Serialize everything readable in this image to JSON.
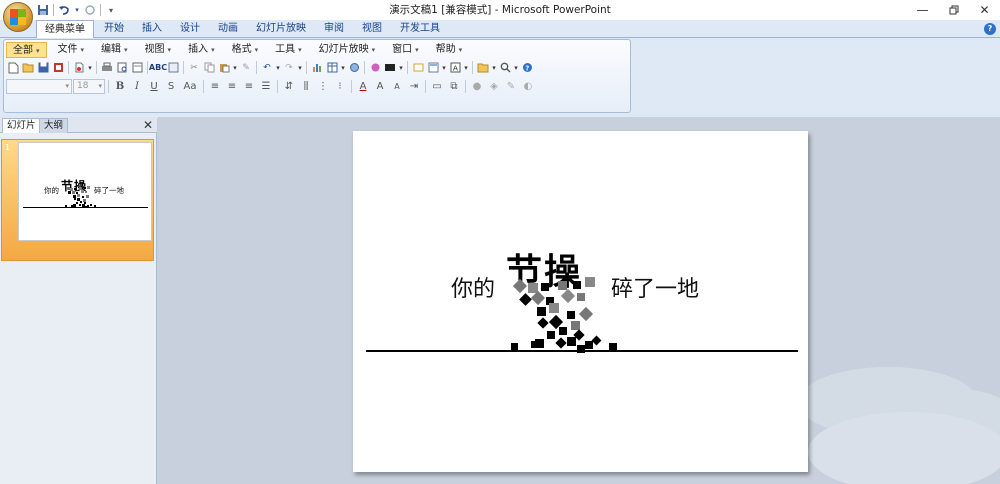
{
  "titlebar": {
    "title": "演示文稿1 [兼容模式] - Microsoft PowerPoint",
    "qat_icons": [
      "save-icon",
      "undo-icon",
      "redo-icon",
      "customize-icon"
    ]
  },
  "tabs": [
    {
      "label": "经典菜单",
      "active": true
    },
    {
      "label": "开始"
    },
    {
      "label": "插入"
    },
    {
      "label": "设计"
    },
    {
      "label": "动画"
    },
    {
      "label": "幻灯片放映"
    },
    {
      "label": "审阅"
    },
    {
      "label": "视图"
    },
    {
      "label": "开发工具"
    }
  ],
  "menu": [
    {
      "label": "全部",
      "active": true
    },
    {
      "label": "文件"
    },
    {
      "label": "编辑"
    },
    {
      "label": "视图"
    },
    {
      "label": "插入"
    },
    {
      "label": "格式"
    },
    {
      "label": "工具"
    },
    {
      "label": "幻灯片放映"
    },
    {
      "label": "窗口"
    },
    {
      "label": "帮助"
    }
  ],
  "format": {
    "font_name": "",
    "font_size": "18"
  },
  "pane": {
    "tab_slides": "幻灯片",
    "tab_outline": "大纲",
    "slide_number": "1"
  },
  "slide": {
    "text_left": "你的",
    "text_big": "节操",
    "text_right": "碎了一地"
  },
  "colors": {
    "accent": "#2b579a",
    "tab_bg": "#dfe9f5",
    "workspace": "#c7d0dc",
    "selection": "#f3a843"
  }
}
